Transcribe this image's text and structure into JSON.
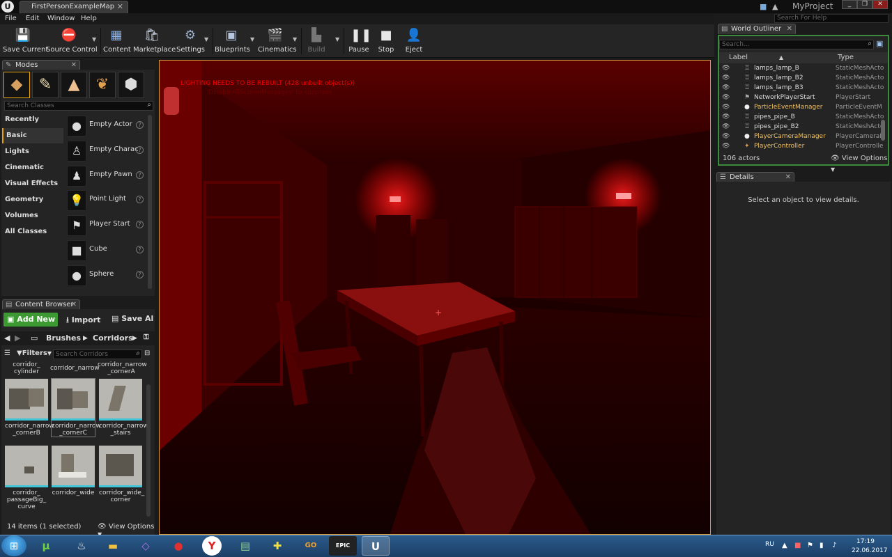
{
  "window": {
    "logo": "U",
    "map_tab": "FirstPersonExampleMap",
    "project_name": "MyProject",
    "help_search_placeholder": "Search For Help",
    "buttons": [
      "_",
      "❐",
      "✕"
    ]
  },
  "menu": [
    "File",
    "Edit",
    "Window",
    "Help"
  ],
  "toolbar": [
    {
      "label": "Save Current",
      "icon": "save-icon"
    },
    {
      "label": "Source Control",
      "icon": "source-control-icon"
    },
    {
      "label": "Content",
      "icon": "content-icon"
    },
    {
      "label": "Marketplace",
      "icon": "marketplace-icon"
    },
    {
      "label": "Settings",
      "icon": "settings-icon"
    },
    {
      "label": "Blueprints",
      "icon": "blueprints-icon"
    },
    {
      "label": "Cinematics",
      "icon": "cinematics-icon"
    },
    {
      "label": "Build",
      "icon": "build-icon"
    },
    {
      "label": "Pause",
      "icon": "pause-icon"
    },
    {
      "label": "Stop",
      "icon": "stop-icon"
    },
    {
      "label": "Eject",
      "icon": "eject-icon"
    }
  ],
  "modes": {
    "tab": "Modes",
    "search_placeholder": "Search Classes",
    "categories": [
      "Recently Placed",
      "Basic",
      "Lights",
      "Cinematic",
      "Visual Effects",
      "Geometry",
      "Volumes",
      "All Classes"
    ],
    "selected_category": "Basic",
    "items": [
      {
        "label": "Empty Actor",
        "icon": "sphere-icon"
      },
      {
        "label": "Empty Charac",
        "icon": "character-icon"
      },
      {
        "label": "Empty Pawn",
        "icon": "pawn-icon"
      },
      {
        "label": "Point Light",
        "icon": "light-bulb-icon"
      },
      {
        "label": "Player Start",
        "icon": "player-start-icon"
      },
      {
        "label": "Cube",
        "icon": "cube-icon"
      },
      {
        "label": "Sphere",
        "icon": "sphere-icon"
      }
    ],
    "help_glyph": "?"
  },
  "content_browser": {
    "tab": "Content Browser",
    "add_new": "Add New",
    "import": "Import",
    "save_all": "Save Al",
    "breadcrumbs": [
      "Brushes",
      "Corridors"
    ],
    "filters": "Filters",
    "search_placeholder": "Search Corridors",
    "top_labels": [
      "corridor_\ncylinder",
      "corridor_narrow",
      "corridor_narrow\n_cornerA"
    ],
    "assets": [
      {
        "label": "corridor_narrow\n_cornerB"
      },
      {
        "label": "corridor_narrow\n_cornerC"
      },
      {
        "label": "corridor_narrow\n_stairs"
      },
      {
        "label": "corridor_\npassageBig_\ncurve"
      },
      {
        "label": "corridor_wide"
      },
      {
        "label": "corridor_wide_\ncorner"
      }
    ],
    "status": "14 items (1 selected)",
    "view_options": "View Options"
  },
  "viewport": {
    "warning": "LIGHTING NEEDS TO BE REBUILT (428 unbuilt object(s))",
    "warning_sub": "'DisableAllScreenMessages' to suppress",
    "crosshair": "+"
  },
  "world_outliner": {
    "tab": "World Outliner",
    "search_placeholder": "Search...",
    "col_label": "Label",
    "col_type": "Type",
    "rows": [
      {
        "label": "lamps_lamp_B",
        "type": "StaticMeshActo"
      },
      {
        "label": "lamps_lamp_B2",
        "type": "StaticMeshActo"
      },
      {
        "label": "lamps_lamp_B3",
        "type": "StaticMeshActo"
      },
      {
        "label": "NetworkPlayerStart",
        "type": "PlayerStart"
      },
      {
        "label": "ParticleEventManager",
        "type": "ParticleEventM"
      },
      {
        "label": "pipes_pipe_B",
        "type": "StaticMeshActo"
      },
      {
        "label": "pipes_pipe_B2",
        "type": "StaticMeshActo"
      },
      {
        "label": "PlayerCameraManager",
        "type": "PlayerCameraM"
      },
      {
        "label": "PlayerController",
        "type": "PlayerControlle"
      }
    ],
    "actor_count": "106 actors",
    "view_options": "View Options"
  },
  "details": {
    "tab": "Details",
    "empty_message": "Select an object to view details."
  },
  "taskbar": {
    "apps": [
      "utorrent-icon",
      "steam-icon",
      "folder-icon",
      "visual-studio-icon",
      "recording-icon",
      "yandex-icon",
      "terminal-icon",
      "game-plus-icon",
      "csgo-icon",
      "epic-games-icon",
      "unreal-engine-icon"
    ],
    "app_glyphs": {
      "utorrent": "µ",
      "steam": "♨",
      "folder": "▬",
      "vs": "◇",
      "rec": "●",
      "yandex": "Y",
      "term": "▤",
      "plus": "✚",
      "csgo": "GO",
      "epic": "EPIC",
      "ue": "U",
      "start": "⊞"
    },
    "language": "RU",
    "time": "17:19",
    "date": "22.06.2017"
  }
}
